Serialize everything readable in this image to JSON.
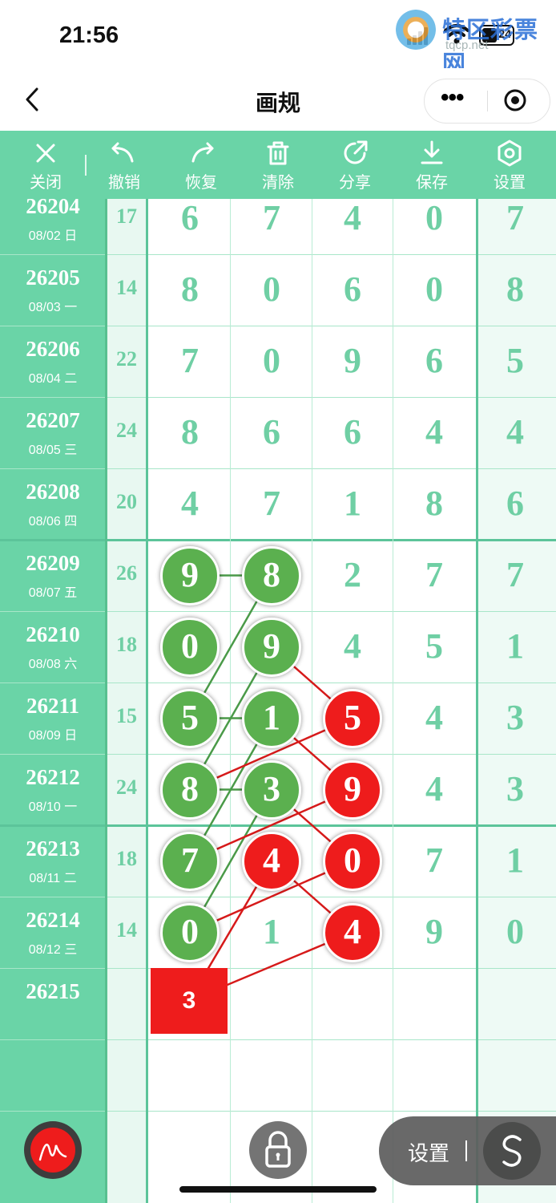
{
  "status": {
    "time": "21:56",
    "battery": "24"
  },
  "watermark": {
    "title": "特区彩票网",
    "url": "tqcp.net"
  },
  "nav": {
    "title": "画规"
  },
  "toolbar": [
    {
      "label": "关闭",
      "icon": "close-icon"
    },
    {
      "label": "撤销",
      "icon": "undo-icon"
    },
    {
      "label": "恢复",
      "icon": "redo-icon"
    },
    {
      "label": "清除",
      "icon": "trash-icon"
    },
    {
      "label": "分享",
      "icon": "share-icon"
    },
    {
      "label": "保存",
      "icon": "download-icon"
    },
    {
      "label": "设置",
      "icon": "settings-icon"
    }
  ],
  "rows": [
    {
      "issue": "26204",
      "date": "08/02 日",
      "sum": "17",
      "d": [
        "6",
        "7",
        "4",
        "0",
        "7"
      ]
    },
    {
      "issue": "26205",
      "date": "08/03 一",
      "sum": "14",
      "d": [
        "8",
        "0",
        "6",
        "0",
        "8"
      ]
    },
    {
      "issue": "26206",
      "date": "08/04 二",
      "sum": "22",
      "d": [
        "7",
        "0",
        "9",
        "6",
        "5"
      ]
    },
    {
      "issue": "26207",
      "date": "08/05 三",
      "sum": "24",
      "d": [
        "8",
        "6",
        "6",
        "4",
        "4"
      ]
    },
    {
      "issue": "26208",
      "date": "08/06 四",
      "sum": "20",
      "d": [
        "4",
        "7",
        "1",
        "8",
        "6"
      ]
    },
    {
      "issue": "26209",
      "date": "08/07 五",
      "sum": "26",
      "d": [
        "9",
        "8",
        "2",
        "7",
        "7"
      ]
    },
    {
      "issue": "26210",
      "date": "08/08 六",
      "sum": "18",
      "d": [
        "0",
        "9",
        "4",
        "5",
        "1"
      ]
    },
    {
      "issue": "26211",
      "date": "08/09 日",
      "sum": "15",
      "d": [
        "5",
        "1",
        "5",
        "4",
        "3"
      ]
    },
    {
      "issue": "26212",
      "date": "08/10 一",
      "sum": "24",
      "d": [
        "8",
        "3",
        "9",
        "4",
        "3"
      ]
    },
    {
      "issue": "26213",
      "date": "08/11 二",
      "sum": "18",
      "d": [
        "7",
        "4",
        "0",
        "7",
        "1"
      ]
    },
    {
      "issue": "26214",
      "date": "08/12 三",
      "sum": "14",
      "d": [
        "0",
        "1",
        "4",
        "9",
        "0"
      ]
    },
    {
      "issue": "26215",
      "date": "",
      "sum": "",
      "d": [
        "",
        "",
        "",
        "",
        ""
      ]
    }
  ],
  "balls": [
    {
      "row": 5,
      "col": 0,
      "color": "green"
    },
    {
      "row": 5,
      "col": 1,
      "color": "green"
    },
    {
      "row": 6,
      "col": 0,
      "color": "green"
    },
    {
      "row": 6,
      "col": 1,
      "color": "green"
    },
    {
      "row": 7,
      "col": 0,
      "color": "green"
    },
    {
      "row": 7,
      "col": 1,
      "color": "green"
    },
    {
      "row": 7,
      "col": 2,
      "color": "red"
    },
    {
      "row": 8,
      "col": 0,
      "color": "green"
    },
    {
      "row": 8,
      "col": 1,
      "color": "green"
    },
    {
      "row": 8,
      "col": 2,
      "color": "red"
    },
    {
      "row": 9,
      "col": 0,
      "color": "green"
    },
    {
      "row": 9,
      "col": 1,
      "color": "red"
    },
    {
      "row": 9,
      "col": 2,
      "color": "red"
    },
    {
      "row": 10,
      "col": 0,
      "color": "green"
    },
    {
      "row": 10,
      "col": 2,
      "color": "red"
    }
  ],
  "prediction": {
    "value": "3"
  },
  "floating": {
    "settings_label": "设置"
  },
  "colors": {
    "accent": "#6ad4a7",
    "ball_green": "#5bb04f",
    "ball_red": "#ee1c1c",
    "digit": "#6fcfa4"
  }
}
